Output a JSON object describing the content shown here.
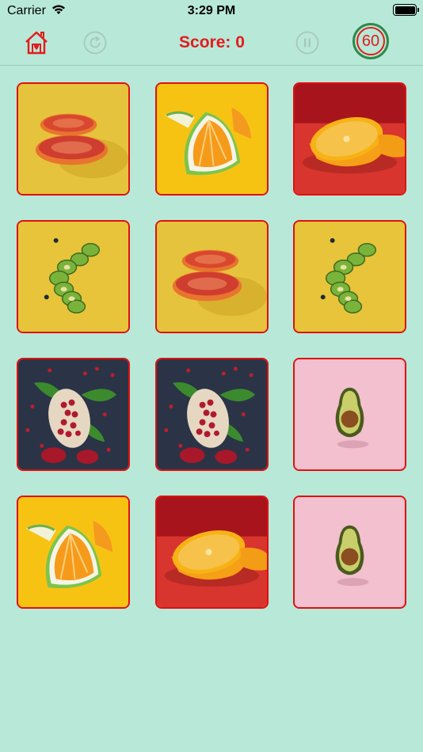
{
  "status_bar": {
    "carrier": "Carrier",
    "time": "3:29 PM",
    "icons": [
      "wifi-icon",
      "battery-icon"
    ]
  },
  "toolbar": {
    "home_icon": "home-icon",
    "restart_icon": "restart-icon",
    "score_label": "Score:",
    "score_value": "0",
    "pause_icon": "pause-icon",
    "timer_value": "60"
  },
  "colors": {
    "background": "#b8e8d8",
    "accent_red": "#e31c1c",
    "timer_ring": "#2f8a4a",
    "muted_icon": "#a9c7bc"
  },
  "board": {
    "rows": 4,
    "columns": 3,
    "cards": [
      {
        "fruit": "blood-orange",
        "background": "yellow"
      },
      {
        "fruit": "orange-wedge",
        "background": "yellow"
      },
      {
        "fruit": "orange-half",
        "background": "red"
      },
      {
        "fruit": "kiwi",
        "background": "yellow"
      },
      {
        "fruit": "blood-orange",
        "background": "yellow"
      },
      {
        "fruit": "kiwi",
        "background": "yellow"
      },
      {
        "fruit": "pomegranate",
        "background": "navy"
      },
      {
        "fruit": "pomegranate",
        "background": "navy"
      },
      {
        "fruit": "avocado",
        "background": "pink"
      },
      {
        "fruit": "orange-wedge",
        "background": "yellow"
      },
      {
        "fruit": "orange-half",
        "background": "red"
      },
      {
        "fruit": "avocado",
        "background": "pink"
      }
    ]
  }
}
